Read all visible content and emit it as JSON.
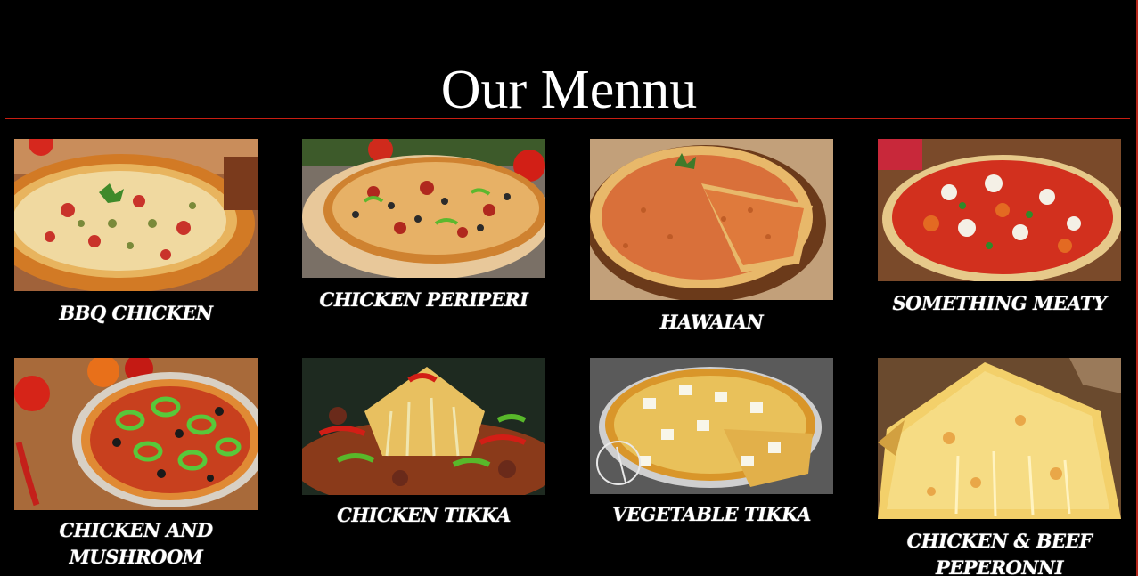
{
  "header": {
    "title": "Our Mennu"
  },
  "menu": {
    "items": [
      {
        "label": "BBQ CHICKEN",
        "photo_icon": "bbq-chicken-pizza-photo"
      },
      {
        "label": "CHICKEN PERIPERI",
        "photo_icon": "chicken-periperi-pizza-photo"
      },
      {
        "label": "HAWAIAN",
        "photo_icon": "hawaiian-pizza-photo"
      },
      {
        "label": "SOMETHING MEATY",
        "photo_icon": "something-meaty-pizza-photo"
      },
      {
        "label": "CHICKEN AND MUSHROOM",
        "photo_icon": "chicken-mushroom-pizza-photo"
      },
      {
        "label": "CHICKEN TIKKA",
        "photo_icon": "chicken-tikka-pizza-photo"
      },
      {
        "label": "VEGETABLE TIKKA",
        "photo_icon": "vegetable-tikka-pizza-photo"
      },
      {
        "label": "CHICKEN & BEEF PEPERONNI",
        "photo_icon": "chicken-beef-pepperoni-pizza-photo"
      }
    ]
  },
  "colors": {
    "background": "#000000",
    "accent": "#c81e12",
    "text": "#ffffff"
  }
}
